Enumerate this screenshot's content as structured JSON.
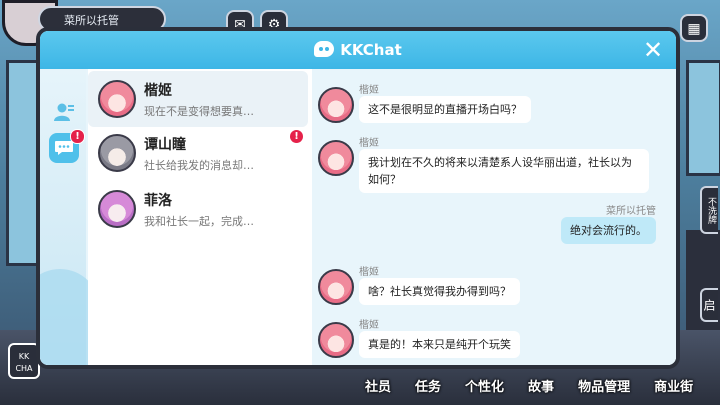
{
  "game": {
    "player_name": "菜所以托管",
    "kk_app_label": "KK CHA",
    "side_tab_label": "不洗牌",
    "side_tab_label2": "启",
    "nav": [
      "社员",
      "任务",
      "个性化",
      "故事",
      "物品管理",
      "商业街"
    ]
  },
  "chat_window": {
    "title": "KKChat",
    "close_icon": "close-icon",
    "accent_color": "#3db6e6",
    "rail": {
      "contacts_icon": "contacts-icon",
      "chat_icon": "chat-bubble-icon",
      "chat_badge": "!"
    },
    "conversations": [
      {
        "name": "楷姬",
        "preview": "现在不是变得想要真…",
        "avatar": "pink-hair-avatar",
        "active": true,
        "unread": ""
      },
      {
        "name": "谭山瞳",
        "preview": "社长给我发的消息却…",
        "avatar": "grey-hair-avatar",
        "active": false,
        "unread": "!"
      },
      {
        "name": "菲洛",
        "preview": "我和社长一起，完成…",
        "avatar": "purple-hair-avatar",
        "active": false,
        "unread": ""
      }
    ],
    "messages": [
      {
        "sender": "楷姬",
        "text": "这不是很明显的直播开场白吗？",
        "self": false
      },
      {
        "sender": "楷姬",
        "text": "我计划在不久的将来以清楚系人设华丽出道，社长以为如何？",
        "self": false
      },
      {
        "sender": "菜所以托管",
        "text": "绝对会流行的。",
        "self": true
      },
      {
        "sender": "楷姬",
        "text": "啥？社长真觉得我办得到吗？",
        "self": false
      },
      {
        "sender": "楷姬",
        "text": "真是的！本来只是纯开个玩笑",
        "self": false
      }
    ]
  }
}
